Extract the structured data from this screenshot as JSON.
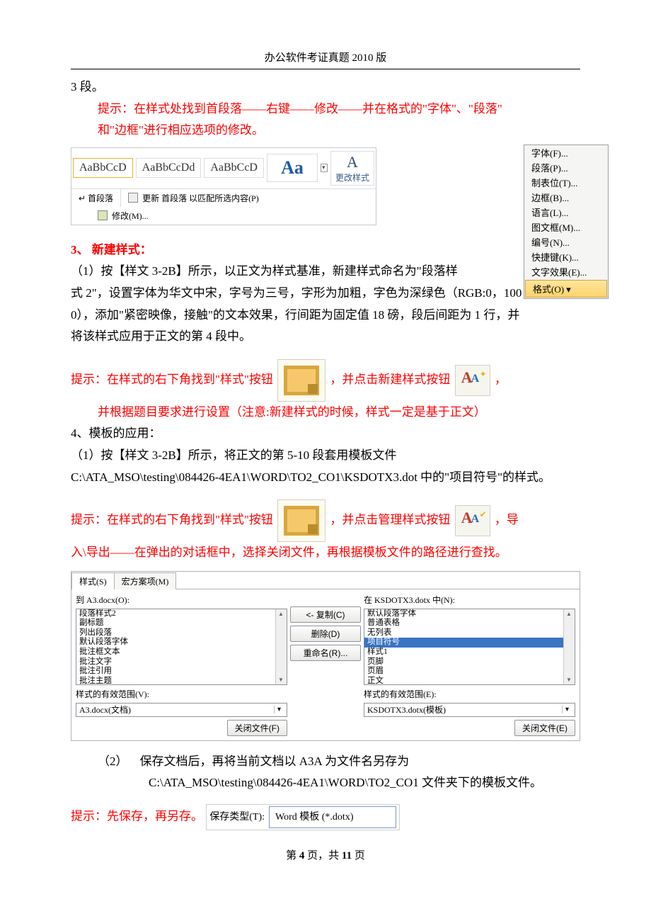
{
  "header": {
    "title": "办公软件考证真题 2010 版"
  },
  "intro": {
    "line1": "3 段。"
  },
  "hint1": {
    "l1": "提示：在样式处找到首段落——右键——修改——并在格式的\"字体\"、\"段落\"",
    "l2": "和\"边框\"进行相应选项的修改。"
  },
  "gallery": {
    "item1": "AaBbCcD",
    "item2": "AaBbCcDd",
    "item3": "AaBbCcD",
    "bigA": "Aa",
    "side_label": "更改样式",
    "foot_left": "↵ 首段落",
    "context_update": "更新 首段落 以匹配所选内容(P)",
    "context_modify": "修改(M)..."
  },
  "format_menu": {
    "items": [
      "字体(F)...",
      "段落(P)...",
      "制表位(T)...",
      "边框(B)...",
      "语言(L)...",
      "图文框(M)...",
      "编号(N)...",
      "快捷键(K)...",
      "文字效果(E)..."
    ],
    "footer": "格式(O) ▾"
  },
  "section3": {
    "title": "3、 新建样式：",
    "para1": "（1）按【样文 3-2B】所示，以正文为样式基准，新建样式命名为\"段落样",
    "para2": "式 2\"，设置字体为华文中宋，字号为三号，字形为加粗，字色为深绿色（RGB:0，100，",
    "para3": "0），添加\"紧密映像，接触\"的文本效果，行间距为固定值 18 磅，段后间距为 1 行，并",
    "para4": "将该样式应用于正文的第 4 段中。",
    "hint_a": "提示：在样式的右下角找到\"样式\"按钮",
    "hint_b": "，并点击新建样式按钮",
    "hint_c": "，",
    "hint_d": "并根据题目要求进行设置（注意:新建样式的时候，样式一定是基于正文）"
  },
  "section4": {
    "title": "4、模板的应用：",
    "p1": "（1）按【样文 3-2B】所示，将正文的第 5-10 段套用模板文件",
    "p2": "C:\\ATA_MSO\\testing\\084426-4EA1\\WORD\\TO2_CO1\\KSDOTX3.dot 中的\"项目符号\"的样式。",
    "hint_a": "提示：在样式的右下角找到\"样式\"按钮",
    "hint_b": "，并点击管理样式按钮",
    "hint_c": "，导",
    "hint_d": "入\\导出——在弹出的对话框中，选择关闭文件，再根据模板文件的路径进行查找。"
  },
  "organizer": {
    "tab1": "样式(S)",
    "tab2": "宏方案项(M)",
    "left_label": "到 A3.docx(O):",
    "right_label": "在 KSDOTX3.dotx 中(N):",
    "left_items": [
      "段落样式2",
      "副标题",
      "列出段落",
      "默认段落字体",
      "批注框文本",
      "批注文字",
      "批注引用",
      "批注主题"
    ],
    "right_items": [
      "默认段落字体",
      "普通表格",
      "无列表",
      "项目符号",
      "样式1",
      "页脚",
      "页眉",
      "正文"
    ],
    "right_selected_index": 3,
    "btn_copy": "<- 复制(C)",
    "btn_delete": "删除(D)",
    "btn_rename": "重命名(R)...",
    "scope_label_l": "样式的有效范围(V):",
    "scope_label_r": "样式的有效范围(E):",
    "combo_l": "A3.docx(文档)",
    "combo_r": "KSDOTX3.dotx(模板)",
    "close_l": "关闭文件(F)",
    "close_r": "关闭文件(E)"
  },
  "section4b": {
    "num": "（2）",
    "l1": "保存文档后，再将当前文档以 A3A 为文件名另存为",
    "l2": "C:\\ATA_MSO\\testing\\084426-4EA1\\WORD\\TO2_CO1 文件夹下的模板文件。"
  },
  "save_hint": {
    "prefix": "提示：先保存，再另存。",
    "label": "保存类型(T):",
    "value": "Word 模板 (*.dotx)"
  },
  "footer": {
    "prefix": "第 ",
    "page": "4",
    "mid": " 页，共 ",
    "total": "11",
    "suffix": " 页"
  }
}
